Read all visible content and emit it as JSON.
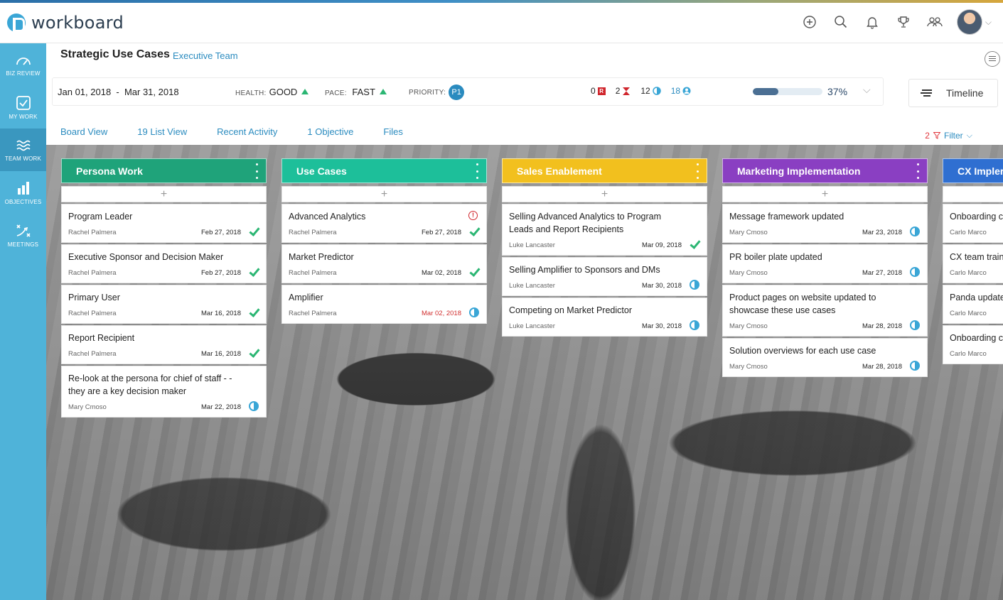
{
  "app": {
    "name": "workboard"
  },
  "sidebar": {
    "items": [
      {
        "label": "BIZ REVIEW",
        "icon": "gauge-icon"
      },
      {
        "label": "MY WORK",
        "icon": "checkbox-icon"
      },
      {
        "label": "TEAM WORK",
        "icon": "waves-icon"
      },
      {
        "label": "OBJECTIVES",
        "icon": "bar-chart-icon"
      },
      {
        "label": "MEETINGS",
        "icon": "play-diagram-icon"
      }
    ],
    "active_index": 2
  },
  "header": {
    "title": "Strategic Use Cases",
    "team": "Executive Team",
    "dates": "Jan 01, 2018  -  Mar 31, 2018",
    "health_label": "HEALTH:",
    "health_value": "GOOD",
    "pace_label": "PACE:",
    "pace_value": "FAST",
    "priority_label": "PRIORITY:",
    "priority_value": "P1",
    "count_red": "0",
    "count_overdue": "2",
    "count_progress": "12",
    "count_people": "18",
    "progress_fraction": 0.37,
    "progress_text": "37%",
    "timeline_label": "Timeline"
  },
  "tabs": [
    {
      "label": "Board View"
    },
    {
      "label": "19 List View"
    },
    {
      "label": "Recent Activity"
    },
    {
      "label": "1 Objective"
    },
    {
      "label": "Files"
    }
  ],
  "filter": {
    "count": "2",
    "label": "Filter"
  },
  "colors": {
    "sidebar": "#4fb3d9",
    "accent": "#2a8bbf",
    "persona": "#1fa37a",
    "usecases": "#1dbf9a",
    "sales": "#f2c01e",
    "marketing": "#8a3fc2",
    "cx": "#2f6fd1"
  },
  "columns": [
    {
      "title": "Persona Work",
      "cards": [
        {
          "title": "Program Leader",
          "owner": "Rachel Palmera",
          "date": "Feb 27, 2018",
          "status": "done"
        },
        {
          "title": "Executive Sponsor and Decision Maker",
          "owner": "Rachel Palmera",
          "date": "Feb 27, 2018",
          "status": "done"
        },
        {
          "title": "Primary User",
          "owner": "Rachel Palmera",
          "date": "Mar 16, 2018",
          "status": "done"
        },
        {
          "title": "Report Recipient",
          "owner": "Rachel Palmera",
          "date": "Mar 16, 2018",
          "status": "done"
        },
        {
          "title": "Re-look at the persona for chief of staff - - they are a key decision maker",
          "owner": "Mary Cmoso",
          "date": "Mar 22, 2018",
          "status": "progress"
        }
      ]
    },
    {
      "title": "Use Cases",
      "cards": [
        {
          "title": "Advanced Analytics",
          "owner": "Rachel Palmera",
          "date": "Feb 27, 2018",
          "status": "done",
          "alert": "!"
        },
        {
          "title": "Market Predictor",
          "owner": "Rachel Palmera",
          "date": "Mar 02, 2018",
          "status": "done"
        },
        {
          "title": "Amplifier",
          "owner": "Rachel Palmera",
          "date": "Mar 02, 2018",
          "status": "progress",
          "late": true
        }
      ]
    },
    {
      "title": "Sales Enablement",
      "cards": [
        {
          "title": "Selling Advanced Analytics to Program Leads and Report Recipients",
          "owner": "Luke Lancaster",
          "date": "Mar 09, 2018",
          "status": "done"
        },
        {
          "title": "Selling Amplifier to Sponsors and DMs",
          "owner": "Luke Lancaster",
          "date": "Mar 30, 2018",
          "status": "progress"
        },
        {
          "title": "Competing on Market Predictor",
          "owner": "Luke Lancaster",
          "date": "Mar 30, 2018",
          "status": "progress"
        }
      ]
    },
    {
      "title": "Marketing Implementation",
      "cards": [
        {
          "title": "Message framework updated",
          "owner": "Mary Cmoso",
          "date": "Mar 23, 2018",
          "status": "progress"
        },
        {
          "title": "PR boiler plate updated",
          "owner": "Mary Cmoso",
          "date": "Mar 27, 2018",
          "status": "progress"
        },
        {
          "title": "Product pages on website updated to showcase these use cases",
          "owner": "Mary Cmoso",
          "date": "Mar 28, 2018",
          "status": "progress"
        },
        {
          "title": "Solution overviews for each use case",
          "owner": "Mary Cmoso",
          "date": "Mar 28, 2018",
          "status": "progress"
        }
      ]
    },
    {
      "title": "CX Impler",
      "cards": [
        {
          "title": "Onboarding c Analytics",
          "owner": "Carlo Marco",
          "date": "",
          "status": ""
        },
        {
          "title": "CX team train",
          "owner": "Carlo Marco",
          "date": "",
          "status": ""
        },
        {
          "title": "Panda update",
          "owner": "Carlo Marco",
          "date": "",
          "status": ""
        },
        {
          "title": "Onboarding c",
          "owner": "Carlo Marco",
          "date": "",
          "status": ""
        }
      ]
    }
  ]
}
